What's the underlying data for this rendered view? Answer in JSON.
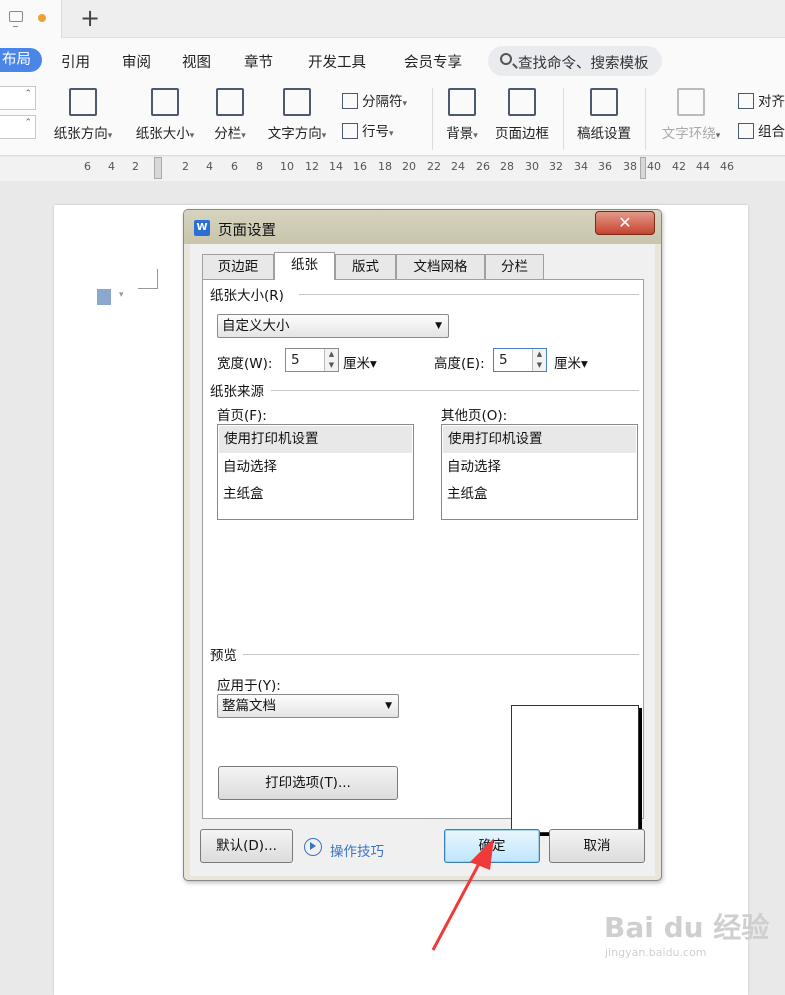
{
  "tabbar": {
    "new_tab": "+"
  },
  "menu": {
    "active": "布局",
    "items": [
      "引用",
      "审阅",
      "视图",
      "章节",
      "开发工具",
      "会员专享"
    ],
    "search_placeholder": "查找命令、搜索模板"
  },
  "ribbon": {
    "orientation": "纸张方向",
    "size": "纸张大小",
    "columns": "分栏",
    "text_direction": "文字方向",
    "separator": "分隔符",
    "line_number": "行号",
    "background": "背景",
    "page_border": "页面边框",
    "manuscript": "稿纸设置",
    "text_wrap": "文字环绕",
    "align": "对齐",
    "group": "组合"
  },
  "ruler": {
    "ticks": [
      "6",
      "4",
      "2",
      "2",
      "4",
      "6",
      "8",
      "10",
      "12",
      "14",
      "16",
      "18",
      "20",
      "22",
      "24",
      "26",
      "28",
      "30",
      "32",
      "34",
      "36",
      "38",
      "40",
      "42",
      "44",
      "46"
    ]
  },
  "dialog": {
    "title": "页面设置",
    "close": "✕",
    "tabs": [
      "页边距",
      "纸张",
      "版式",
      "文档网格",
      "分栏"
    ],
    "active_tab": "纸张",
    "paper_size_group": "纸张大小(R)",
    "paper_size_value": "自定义大小",
    "width_label": "宽度(W):",
    "width_value": "5",
    "height_label": "高度(E):",
    "height_value": "5",
    "unit": "厘米",
    "paper_source_group": "纸张来源",
    "first_page_label": "首页(F):",
    "other_pages_label": "其他页(O):",
    "source_items": [
      "使用打印机设置",
      "自动选择",
      "主纸盒"
    ],
    "preview_group": "预览",
    "apply_to_label": "应用于(Y):",
    "apply_to_value": "整篇文档",
    "print_options": "打印选项(T)...",
    "default_button": "默认(D)...",
    "tips": "操作技巧",
    "ok": "确定",
    "cancel": "取消"
  },
  "watermark": {
    "brand": "Bai du 经验",
    "url": "jingyan.baidu.com"
  },
  "colors": {
    "accent": "#4a86e8",
    "arrow": "#f03a3a",
    "link": "#3a74c6"
  }
}
